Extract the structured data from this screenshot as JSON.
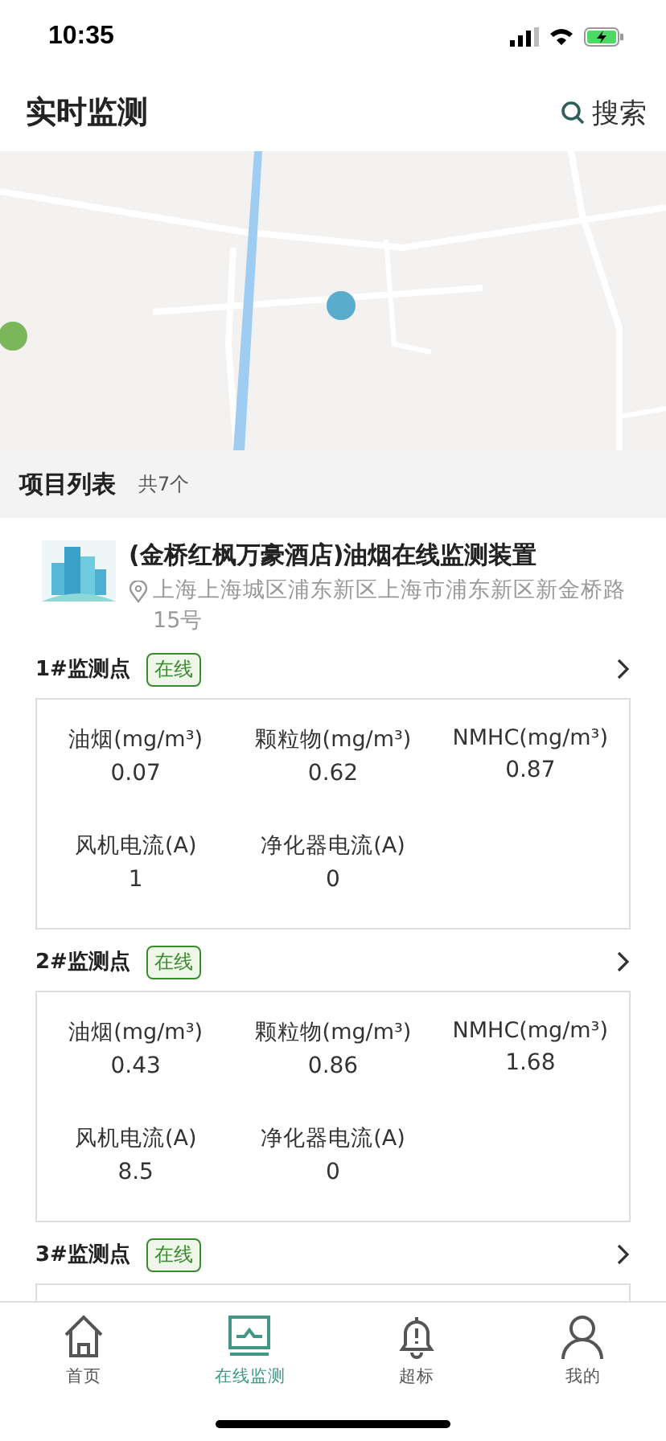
{
  "status_bar": {
    "time": "10:35"
  },
  "header": {
    "title": "实时监测",
    "search_label": "搜索"
  },
  "list_header": {
    "title": "项目列表",
    "count": "共7个"
  },
  "project": {
    "name": "(金桥红枫万豪酒店)油烟在线监测装置",
    "address": "上海上海城区浦东新区上海市浦东新区新金桥路15号"
  },
  "points": [
    {
      "name": "1#监测点",
      "status": "在线",
      "online": true,
      "metrics": [
        {
          "label": "油烟(mg/m³)",
          "value": "0.07"
        },
        {
          "label": "颗粒物(mg/m³)",
          "value": "0.62"
        },
        {
          "label": "NMHC(mg/m³)",
          "value": "0.87"
        },
        {
          "label": "风机电流(A)",
          "value": "1"
        },
        {
          "label": "净化器电流(A)",
          "value": "0"
        }
      ]
    },
    {
      "name": "2#监测点",
      "status": "在线",
      "online": true,
      "metrics": [
        {
          "label": "油烟(mg/m³)",
          "value": "0.43"
        },
        {
          "label": "颗粒物(mg/m³)",
          "value": "0.86"
        },
        {
          "label": "NMHC(mg/m³)",
          "value": "1.68"
        },
        {
          "label": "风机电流(A)",
          "value": "8.5"
        },
        {
          "label": "净化器电流(A)",
          "value": "0"
        }
      ]
    },
    {
      "name": "3#监测点",
      "status": "在线",
      "online": true
    }
  ],
  "tabs": [
    {
      "kind": "home",
      "label": "首页",
      "selected": false
    },
    {
      "kind": "monitor",
      "label": "在线监测",
      "selected": true
    },
    {
      "kind": "alarm",
      "label": "超标",
      "selected": false
    },
    {
      "kind": "user",
      "label": "我的",
      "selected": false
    }
  ]
}
